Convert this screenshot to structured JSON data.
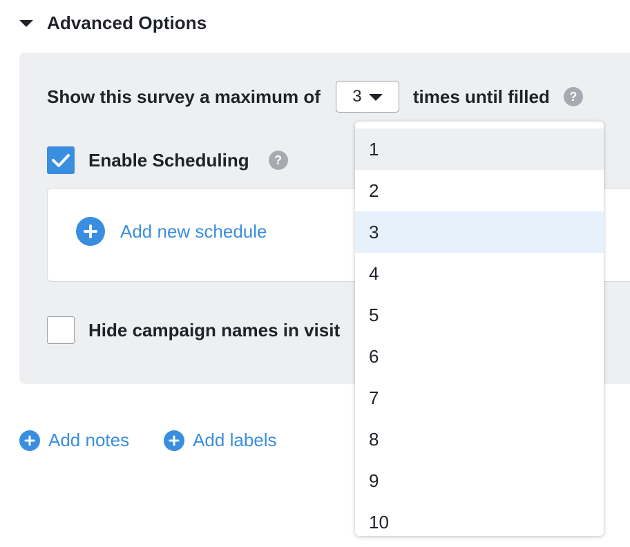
{
  "section": {
    "title": "Advanced Options",
    "expanded": true
  },
  "max_display": {
    "label_before": "Show this survey a maximum of",
    "selected_value": "3",
    "label_after": "times until filled",
    "help_glyph": "?"
  },
  "scheduling": {
    "label": "Enable Scheduling",
    "checked": true,
    "help_glyph": "?",
    "add_schedule_label": "Add new schedule"
  },
  "hide_campaign": {
    "label": "Hide campaign names in visit",
    "checked": false
  },
  "bottom_links": {
    "add_notes": "Add notes",
    "add_labels": "Add labels"
  },
  "dropdown": {
    "options": [
      "1",
      "2",
      "3",
      "4",
      "5",
      "6",
      "7",
      "8",
      "9",
      "10"
    ],
    "hovered_index": 0,
    "selected_index": 2
  },
  "colors": {
    "accent": "#3a8ee0",
    "panel_bg": "#eeeff1",
    "selected_option_bg": "#e6f1fb",
    "hovered_option_bg": "#eeeff1",
    "help_icon_bg": "#a7aab0",
    "text": "#1f2329"
  },
  "icons": {
    "section_toggle": "caret-down-icon",
    "select_toggle": "caret-down-icon",
    "help": "question-circle-icon",
    "check": "checkmark-icon",
    "add": "plus-circle-icon"
  }
}
